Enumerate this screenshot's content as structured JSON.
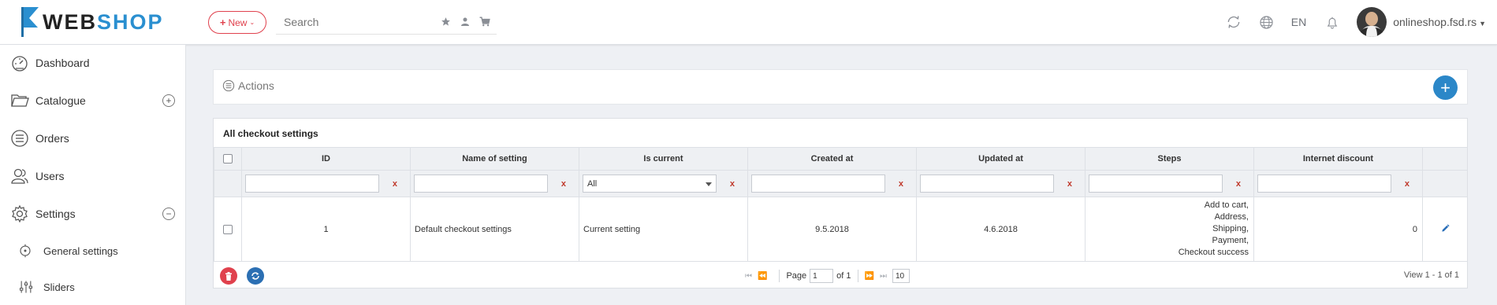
{
  "header": {
    "logo_web": "WEB",
    "logo_shop": "SHOP",
    "new_button": "New",
    "search_placeholder": "Search",
    "language": "EN",
    "user_name": "onlineshop.fsd.rs",
    "accent_color": "#2a8fd0",
    "new_color": "#e0414d"
  },
  "sidebar": {
    "items": [
      {
        "label": "Dashboard",
        "icon": "dashboard-icon"
      },
      {
        "label": "Catalogue",
        "icon": "folder-icon",
        "toggle": "+"
      },
      {
        "label": "Orders",
        "icon": "list-icon"
      },
      {
        "label": "Users",
        "icon": "users-icon"
      },
      {
        "label": "Settings",
        "icon": "gear-icon",
        "toggle": "−"
      }
    ],
    "sub_items": [
      {
        "label": "General settings",
        "icon": "general-settings-icon"
      },
      {
        "label": "Sliders",
        "icon": "sliders-icon"
      }
    ]
  },
  "actions": {
    "label": "Actions",
    "add_button": "+"
  },
  "grid": {
    "title": "All checkout settings",
    "columns": [
      "ID",
      "Name of setting",
      "Is current",
      "Created at",
      "Updated at",
      "Steps",
      "Internet discount"
    ],
    "filter_clear": "x",
    "is_current_filter_value": "All",
    "rows": [
      {
        "id": "1",
        "name": "Default checkout settings",
        "is_current": "Current setting",
        "created_at": "9.5.2018",
        "updated_at": "4.6.2018",
        "steps": [
          "Add to cart,",
          "Address,",
          "Shipping,",
          "Payment,",
          "Checkout success"
        ],
        "internet_discount": "0"
      }
    ],
    "pager": {
      "page_label": "Page",
      "page_value": "1",
      "of_label": "of 1",
      "page_size": "10",
      "view_count": "View 1 - 1 of 1"
    }
  }
}
